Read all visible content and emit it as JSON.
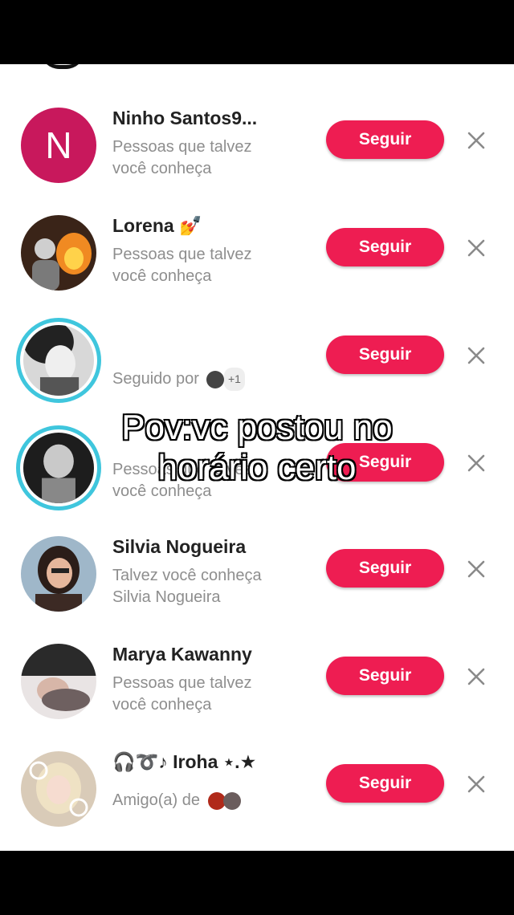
{
  "follow_label": "Seguir",
  "suggestions": [
    {
      "name": "Ninho Santos9...",
      "avatar_letter": "N",
      "subtitle_line1": "Pessoas que talvez",
      "subtitle_line2": "você conheça"
    },
    {
      "name": "Lorena 💅",
      "subtitle_line1": "Pessoas que talvez",
      "subtitle_line2": "você conheça"
    },
    {
      "name": "",
      "subtitle_line1": "Seguido por",
      "extra_count": "+1"
    },
    {
      "name": "",
      "subtitle_line1": "Pessoas que talvez",
      "subtitle_line2": "você conheça"
    },
    {
      "name": "Silvia Nogueira",
      "subtitle_line1": "Talvez você conheça",
      "subtitle_line2": "Silvia Nogueira"
    },
    {
      "name": "Marya Kawanny",
      "subtitle_line1": "Pessoas que talvez",
      "subtitle_line2": "você conheça"
    },
    {
      "name": "🎧➰♪ Iroha ⋆.★",
      "subtitle_line1": "Amigo(a) de"
    }
  ],
  "overlay_caption": {
    "line1": "Pov:vc postou no",
    "line2": "horário certo"
  },
  "colors": {
    "accent": "#ee1d52",
    "ring": "#3fc6dd",
    "avatar_letter_bg": "#c8185c"
  }
}
